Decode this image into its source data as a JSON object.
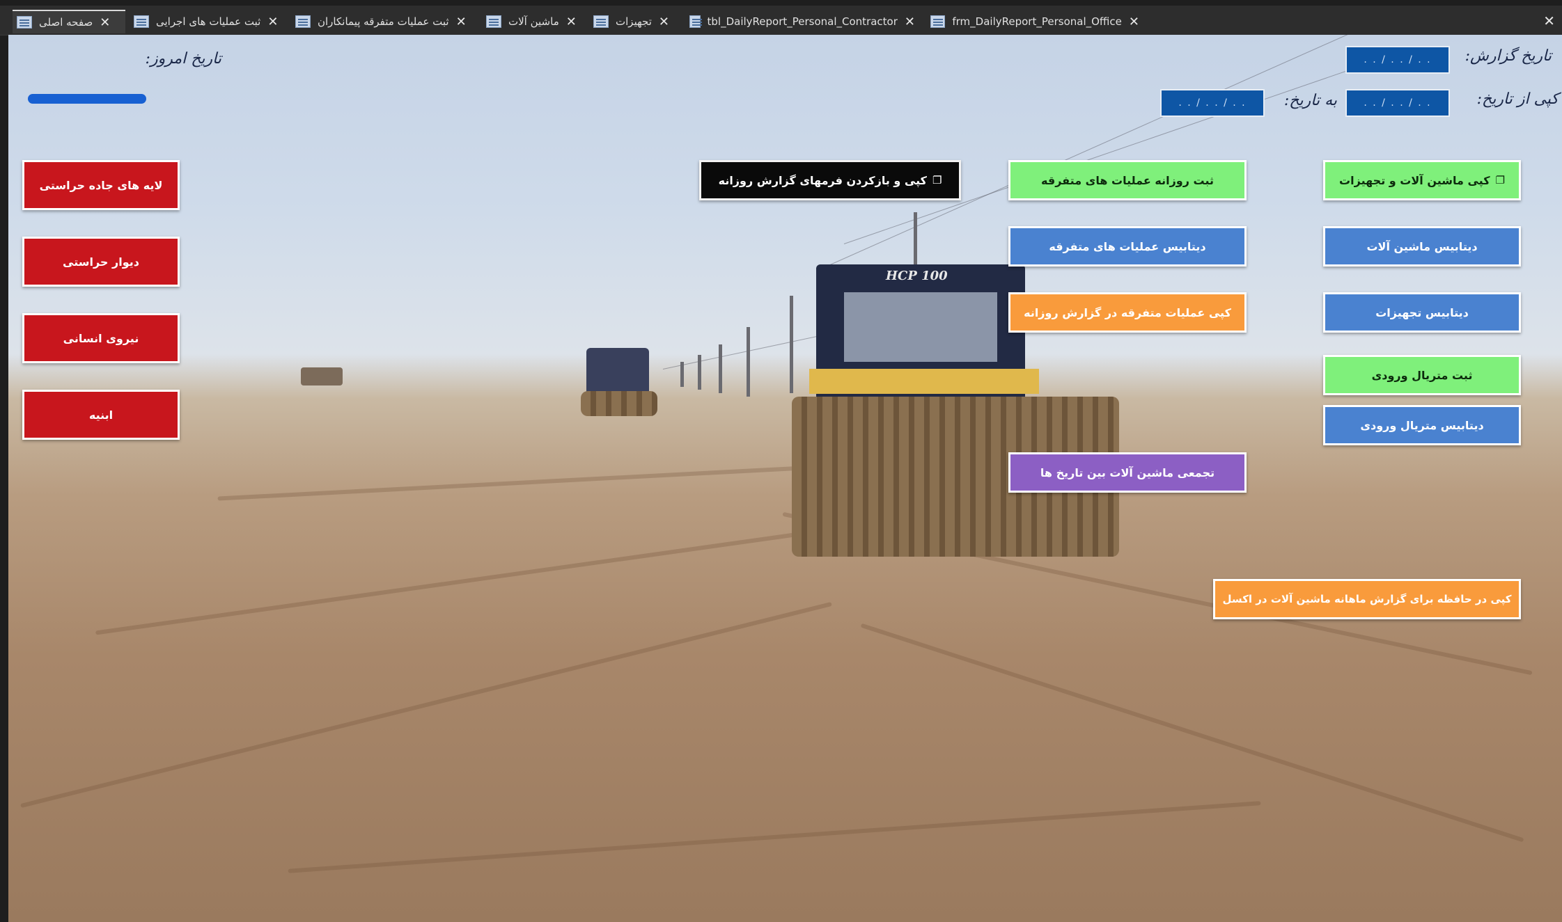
{
  "tabs": [
    {
      "label": "صفحه اصلی",
      "active": true
    },
    {
      "label": "ثبت عملیات های اجرایی"
    },
    {
      "label": "ثبت عملیات متفرقه پیمانکاران"
    },
    {
      "label": "ماشین آلات"
    },
    {
      "label": "تجهیزات"
    },
    {
      "label": "tbl_DailyReport_Personal_Contractor"
    },
    {
      "label": "frm_DailyReport_Personal_Office"
    }
  ],
  "tab_close_glyph": "✕",
  "header": {
    "report_date_label": "تاریخ گزارش:",
    "report_date_value": ". . / . . / . .",
    "copy_from_label": "کپی از تاریخ:",
    "copy_from_value": ". . / . . / . .",
    "to_date_label": "به تاریخ:",
    "to_date_value": ". . / . . / . .",
    "today_label": "تاریخ امروز:"
  },
  "buttons": {
    "road_layers": "لایه های جاده حراستی",
    "protection_wall": "دیوار حراستی",
    "manpower": "نیروی انسانی",
    "buildings": "ابنیه",
    "copy_open_forms": "کپی و بازکردن فرمهای گزارش روزانه",
    "daily_misc_ops": "ثبت روزانه عملیات های متفرقه",
    "copy_machinery_equipment": "کپی ماشین آلات و تجهیزات",
    "misc_ops_db": "دیتابیس عملیات های متفرقه",
    "machinery_db": "دیتابیس ماشین آلات",
    "copy_misc_ops_daily": "کپی عملیات متفرقه  در گزارش روزانه",
    "equipment_db": "دیتابیس تجهیزات",
    "register_input_material": "ثبت متریال ورودی",
    "input_material_db": "دیتابیس متریال ورودی",
    "machinery_between_dates": "تجمعی ماشین آلات بین تاریخ ها",
    "copy_clipboard_monthly": "کپی در حافظه برای گزارش ماهانه ماشین آلات در اکسل"
  },
  "scene": {
    "roller_label": "HCP 100"
  },
  "colors": {
    "red": "#c8161d",
    "green": "#7ff07b",
    "blue": "#4a82d0",
    "orange": "#f99b3c",
    "purple": "#8c5fc4",
    "date_box": "#0e56a5"
  }
}
